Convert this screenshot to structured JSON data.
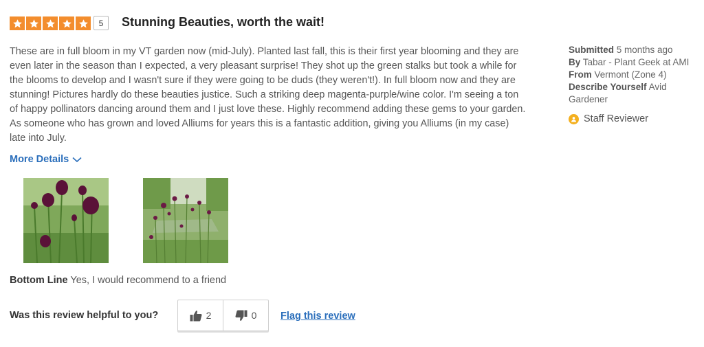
{
  "rating": {
    "stars": 5,
    "max_stars": 5,
    "count_label": "5",
    "star_color": "#f38d2d"
  },
  "review": {
    "title": "Stunning Beauties, worth the wait!",
    "body": "These are in full bloom in my VT garden now (mid-July). Planted last fall, this is their first year blooming and they are even later in the season than I expected, a very pleasant surprise! They shot up the green stalks but took a while for the blooms to develop and I wasn't sure if they were going to be duds (they weren't!). In full bloom now and they are stunning! Pictures hardly do these beauties justice. Such a striking deep magenta-purple/wine color. I'm seeing a ton of happy pollinators dancing around them and I just love these. Highly recommend adding these gems to your garden. As someone who has grown and loved Alliums for years this is a fantastic addition, giving you Alliums (in my case) late into July.",
    "more_details_label": "More Details",
    "bottom_line_label": "Bottom Line",
    "bottom_line_value": "Yes, I would recommend to a friend"
  },
  "meta": {
    "submitted_label": "Submitted",
    "submitted_value": "5 months ago",
    "by_label": "By",
    "by_value": "Tabar - Plant Geek at AMI",
    "from_label": "From",
    "from_value": "Vermont (Zone 4)",
    "describe_label": "Describe Yourself",
    "describe_value": "Avid Gardener",
    "staff_badge": "Staff Reviewer"
  },
  "photos": [
    {
      "icon": "allium-photo-closeup"
    },
    {
      "icon": "allium-photo-garden"
    }
  ],
  "helpful": {
    "question": "Was this review helpful to you?",
    "upvotes": "2",
    "downvotes": "0",
    "flag_label": "Flag this review"
  },
  "colors": {
    "link": "#2a6ebb",
    "badge": "#f4b01f"
  }
}
